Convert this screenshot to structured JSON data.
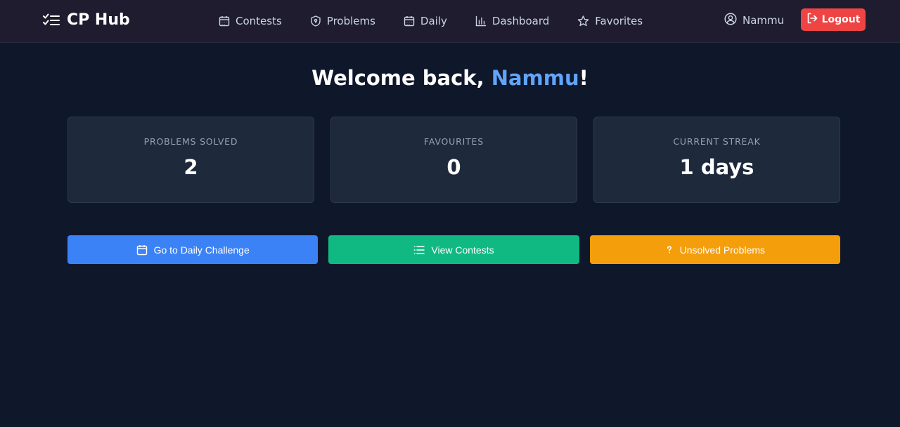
{
  "navbar": {
    "brand": {
      "icon": "checklist-icon",
      "title": "CP Hub"
    },
    "links": [
      {
        "label": "Contests",
        "icon": "calendar-icon"
      },
      {
        "label": "Problems",
        "icon": "shield-icon"
      },
      {
        "label": "Daily",
        "icon": "calendar-icon"
      },
      {
        "label": "Dashboard",
        "icon": "bar-chart-icon"
      },
      {
        "label": "Favorites",
        "icon": "star-icon"
      }
    ],
    "user": {
      "icon": "user-circle-icon",
      "name": "Nammu"
    },
    "logout": {
      "icon": "logout-icon",
      "label": "Logout"
    }
  },
  "welcome": {
    "prefix": "Welcome back, ",
    "name": "Nammu",
    "suffix": "!"
  },
  "stats": [
    {
      "label": "PROBLEMS SOLVED",
      "value": "2"
    },
    {
      "label": "FAVOURITES",
      "value": "0"
    },
    {
      "label": "CURRENT STREAK",
      "value": "1 days"
    }
  ],
  "actions": [
    {
      "label": "Go to Daily Challenge",
      "icon": "calendar-icon",
      "color": "#3b82f6"
    },
    {
      "label": "View Contests",
      "icon": "list-icon",
      "color": "#10b981"
    },
    {
      "label": "Unsolved Problems",
      "icon": "question-icon",
      "color": "#f59e0b"
    }
  ],
  "colors": {
    "background": "#0f172a",
    "navbar": "#1e1c2e",
    "card": "#1e293b",
    "accent": "#60a5fa",
    "logout": "#ef4444"
  }
}
